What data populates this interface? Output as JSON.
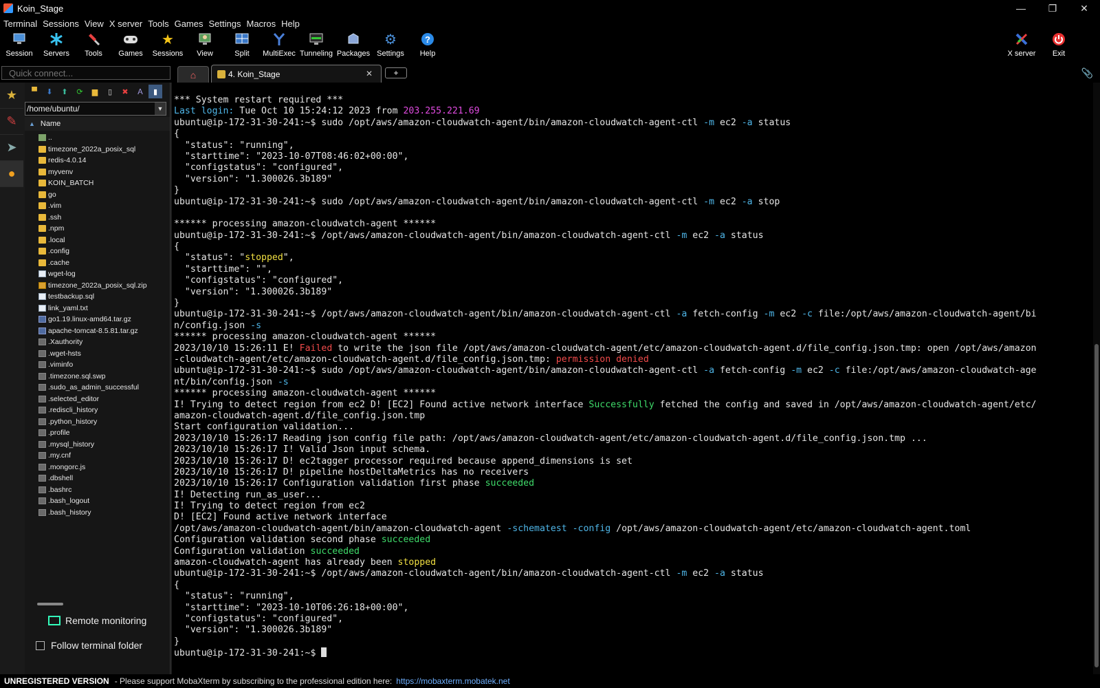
{
  "window": {
    "title": "Koin_Stage",
    "minimize": "—",
    "restore": "❐",
    "close": "✕"
  },
  "menu": [
    "Terminal",
    "Sessions",
    "View",
    "X server",
    "Tools",
    "Games",
    "Settings",
    "Macros",
    "Help"
  ],
  "toolbar": {
    "session": "Session",
    "servers": "Servers",
    "tools": "Tools",
    "games": "Games",
    "sessions": "Sessions",
    "view": "View",
    "split": "Split",
    "multiexec": "MultiExec",
    "tunneling": "Tunneling",
    "packages": "Packages",
    "settings": "Settings",
    "help": "Help",
    "xserver": "X server",
    "exit": "Exit"
  },
  "tabs": {
    "quick_connect_placeholder": "Quick connect...",
    "session_tab": "4. Koin_Stage",
    "close": "✕",
    "new_tab": "+"
  },
  "sidebar": {
    "path": "/home/ubuntu/",
    "column_name": "Name",
    "files": [
      {
        "name": "..",
        "kind": "up"
      },
      {
        "name": "timezone_2022a_posix_sql",
        "kind": "folder"
      },
      {
        "name": "redis-4.0.14",
        "kind": "folder"
      },
      {
        "name": "myvenv",
        "kind": "folder"
      },
      {
        "name": "KOIN_BATCH",
        "kind": "folder"
      },
      {
        "name": "go",
        "kind": "folder"
      },
      {
        "name": ".vim",
        "kind": "folder"
      },
      {
        "name": ".ssh",
        "kind": "folder"
      },
      {
        "name": ".npm",
        "kind": "folder"
      },
      {
        "name": ".local",
        "kind": "folder"
      },
      {
        "name": ".config",
        "kind": "folder"
      },
      {
        "name": ".cache",
        "kind": "folder"
      },
      {
        "name": "wget-log",
        "kind": "doc"
      },
      {
        "name": "timezone_2022a_posix_sql.zip",
        "kind": "zip"
      },
      {
        "name": "testbackup.sql",
        "kind": "doc"
      },
      {
        "name": "link_yaml.txt",
        "kind": "doc"
      },
      {
        "name": "go1.19.linux-amd64.tar.gz",
        "kind": "gz"
      },
      {
        "name": "apache-tomcat-8.5.81.tar.gz",
        "kind": "gz"
      },
      {
        "name": ".Xauthority",
        "kind": "dot"
      },
      {
        "name": ".wget-hsts",
        "kind": "dot"
      },
      {
        "name": ".viminfo",
        "kind": "dot"
      },
      {
        "name": ".timezone.sql.swp",
        "kind": "dot"
      },
      {
        "name": ".sudo_as_admin_successful",
        "kind": "dot"
      },
      {
        "name": ".selected_editor",
        "kind": "dot"
      },
      {
        "name": ".rediscli_history",
        "kind": "dot"
      },
      {
        "name": ".python_history",
        "kind": "dot"
      },
      {
        "name": ".profile",
        "kind": "dot"
      },
      {
        "name": ".mysql_history",
        "kind": "dot"
      },
      {
        "name": ".my.cnf",
        "kind": "dot"
      },
      {
        "name": ".mongorc.js",
        "kind": "dot"
      },
      {
        "name": ".dbshell",
        "kind": "dot"
      },
      {
        "name": ".bashrc",
        "kind": "dot"
      },
      {
        "name": ".bash_logout",
        "kind": "dot"
      },
      {
        "name": ".bash_history",
        "kind": "dot"
      }
    ],
    "remote_monitoring": "Remote monitoring",
    "follow_terminal": "Follow terminal folder"
  },
  "terminal": {
    "lines": [
      [
        {
          "t": "*** System restart required ***"
        }
      ],
      [
        {
          "t": "Last login: ",
          "c": "cyan"
        },
        {
          "t": "Tue Oct 10 15:24:12 2023 from "
        },
        {
          "t": "203.255.221.69",
          "c": "mag"
        }
      ],
      [
        {
          "t": "ubuntu@ip-172-31-30-241:~$ sudo /opt/aws/amazon-cloudwatch-agent/bin/amazon-cloudwatch-agent-ctl "
        },
        {
          "t": "-m",
          "c": "cyan"
        },
        {
          "t": " ec2 "
        },
        {
          "t": "-a",
          "c": "cyan"
        },
        {
          "t": " status"
        }
      ],
      [
        {
          "t": "{"
        }
      ],
      [
        {
          "t": "  \"status\": \"running\","
        }
      ],
      [
        {
          "t": "  \"starttime\": \"2023-10-07T08:46:02+00:00\","
        }
      ],
      [
        {
          "t": "  \"configstatus\": \"configured\","
        }
      ],
      [
        {
          "t": "  \"version\": \"1.300026.3b189\""
        }
      ],
      [
        {
          "t": "}"
        }
      ],
      [
        {
          "t": "ubuntu@ip-172-31-30-241:~$ sudo /opt/aws/amazon-cloudwatch-agent/bin/amazon-cloudwatch-agent-ctl "
        },
        {
          "t": "-m",
          "c": "cyan"
        },
        {
          "t": " ec2 "
        },
        {
          "t": "-a",
          "c": "cyan"
        },
        {
          "t": " stop"
        }
      ],
      [
        {
          "t": ""
        }
      ],
      [
        {
          "t": "****** processing amazon-cloudwatch-agent ******"
        }
      ],
      [
        {
          "t": "ubuntu@ip-172-31-30-241:~$ /opt/aws/amazon-cloudwatch-agent/bin/amazon-cloudwatch-agent-ctl "
        },
        {
          "t": "-m",
          "c": "cyan"
        },
        {
          "t": " ec2 "
        },
        {
          "t": "-a",
          "c": "cyan"
        },
        {
          "t": " status"
        }
      ],
      [
        {
          "t": "{"
        }
      ],
      [
        {
          "t": "  \"status\": \""
        },
        {
          "t": "stopped",
          "c": "yellow"
        },
        {
          "t": "\","
        }
      ],
      [
        {
          "t": "  \"starttime\": \"\","
        }
      ],
      [
        {
          "t": "  \"configstatus\": \"configured\","
        }
      ],
      [
        {
          "t": "  \"version\": \"1.300026.3b189\""
        }
      ],
      [
        {
          "t": "}"
        }
      ],
      [
        {
          "t": "ubuntu@ip-172-31-30-241:~$ /opt/aws/amazon-cloudwatch-agent/bin/amazon-cloudwatch-agent-ctl "
        },
        {
          "t": "-a",
          "c": "cyan"
        },
        {
          "t": " fetch-config "
        },
        {
          "t": "-m",
          "c": "cyan"
        },
        {
          "t": " ec2 "
        },
        {
          "t": "-c",
          "c": "cyan"
        },
        {
          "t": " file:/opt/aws/amazon-cloudwatch-agent/bi"
        }
      ],
      [
        {
          "t": "n/config.json "
        },
        {
          "t": "-s",
          "c": "cyan"
        }
      ],
      [
        {
          "t": "****** processing amazon-cloudwatch-agent ******"
        }
      ],
      [
        {
          "t": "2023/10/10 15:26:11 E! "
        },
        {
          "t": "Failed",
          "c": "red"
        },
        {
          "t": " to write the json file /opt/aws/amazon-cloudwatch-agent/etc/amazon-cloudwatch-agent.d/file_config.json.tmp: open /opt/aws/amazon"
        }
      ],
      [
        {
          "t": "-cloudwatch-agent/etc/amazon-cloudwatch-agent.d/file_config.json.tmp: "
        },
        {
          "t": "permission denied",
          "c": "red"
        }
      ],
      [
        {
          "t": "ubuntu@ip-172-31-30-241:~$ sudo /opt/aws/amazon-cloudwatch-agent/bin/amazon-cloudwatch-agent-ctl "
        },
        {
          "t": "-a",
          "c": "cyan"
        },
        {
          "t": " fetch-config "
        },
        {
          "t": "-m",
          "c": "cyan"
        },
        {
          "t": " ec2 "
        },
        {
          "t": "-c",
          "c": "cyan"
        },
        {
          "t": " file:/opt/aws/amazon-cloudwatch-age"
        }
      ],
      [
        {
          "t": "nt/bin/config.json "
        },
        {
          "t": "-s",
          "c": "cyan"
        }
      ],
      [
        {
          "t": "****** processing amazon-cloudwatch-agent ******"
        }
      ],
      [
        {
          "t": "I! Trying to detect region from ec2 D! [EC2] Found active network interface "
        },
        {
          "t": "Successfully",
          "c": "green"
        },
        {
          "t": " fetched the config and saved in /opt/aws/amazon-cloudwatch-agent/etc/"
        }
      ],
      [
        {
          "t": "amazon-cloudwatch-agent.d/file_config.json.tmp"
        }
      ],
      [
        {
          "t": "Start configuration validation..."
        }
      ],
      [
        {
          "t": "2023/10/10 15:26:17 Reading json config file path: /opt/aws/amazon-cloudwatch-agent/etc/amazon-cloudwatch-agent.d/file_config.json.tmp ..."
        }
      ],
      [
        {
          "t": "2023/10/10 15:26:17 I! Valid Json input schema."
        }
      ],
      [
        {
          "t": "2023/10/10 15:26:17 D! ec2tagger processor required because append_dimensions is set"
        }
      ],
      [
        {
          "t": "2023/10/10 15:26:17 D! pipeline hostDeltaMetrics has no receivers"
        }
      ],
      [
        {
          "t": "2023/10/10 15:26:17 Configuration validation first phase "
        },
        {
          "t": "succeeded",
          "c": "green"
        }
      ],
      [
        {
          "t": "I! Detecting run_as_user..."
        }
      ],
      [
        {
          "t": "I! Trying to detect region from ec2"
        }
      ],
      [
        {
          "t": "D! [EC2] Found active network interface"
        }
      ],
      [
        {
          "t": "/opt/aws/amazon-cloudwatch-agent/bin/amazon-cloudwatch-agent "
        },
        {
          "t": "-schematest",
          "c": "cyan"
        },
        {
          "t": " "
        },
        {
          "t": "-config",
          "c": "cyan"
        },
        {
          "t": " /opt/aws/amazon-cloudwatch-agent/etc/amazon-cloudwatch-agent.toml"
        }
      ],
      [
        {
          "t": "Configuration validation second phase "
        },
        {
          "t": "succeeded",
          "c": "green"
        }
      ],
      [
        {
          "t": "Configuration validation "
        },
        {
          "t": "succeeded",
          "c": "green"
        }
      ],
      [
        {
          "t": "amazon-cloudwatch-agent has already been "
        },
        {
          "t": "stopped",
          "c": "yellow"
        }
      ],
      [
        {
          "t": "ubuntu@ip-172-31-30-241:~$ /opt/aws/amazon-cloudwatch-agent/bin/amazon-cloudwatch-agent-ctl "
        },
        {
          "t": "-m",
          "c": "cyan"
        },
        {
          "t": " ec2 "
        },
        {
          "t": "-a",
          "c": "cyan"
        },
        {
          "t": " status"
        }
      ],
      [
        {
          "t": "{"
        }
      ],
      [
        {
          "t": "  \"status\": \"running\","
        }
      ],
      [
        {
          "t": "  \"starttime\": \"2023-10-10T06:26:18+00:00\","
        }
      ],
      [
        {
          "t": "  \"configstatus\": \"configured\","
        }
      ],
      [
        {
          "t": "  \"version\": \"1.300026.3b189\""
        }
      ],
      [
        {
          "t": "}"
        }
      ]
    ],
    "prompt": "ubuntu@ip-172-31-30-241:~$ "
  },
  "status": {
    "unregistered": "UNREGISTERED VERSION",
    "message": "-  Please support MobaXterm by subscribing to the professional edition here:",
    "link": "https://mobaxterm.mobatek.net"
  },
  "colors": {
    "cyan": "#4fb6e8",
    "magenta": "#e04be0",
    "yellow": "#f2e042",
    "red": "#f24b4b",
    "green": "#3fdb6a"
  }
}
